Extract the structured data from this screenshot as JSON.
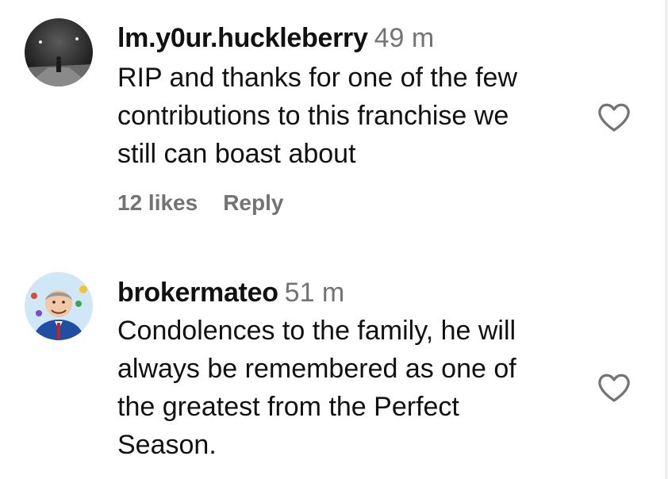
{
  "comments": [
    {
      "username": "lm.y0ur.huckleberry",
      "time": "49 m",
      "text": "RIP and thanks for one of the few\ncontributions to this franchise we\nstill can boast about",
      "likes": "12 likes",
      "reply": "Reply"
    },
    {
      "username": "brokermateo",
      "time": "51 m",
      "text": "Condolences to the family, he will\nalways be remembered as one of\nthe greatest from the Perfect\nSeason."
    }
  ],
  "icons": {
    "like": "heart-outline-icon"
  },
  "colors": {
    "text": "#111111",
    "meta": "#737373"
  }
}
